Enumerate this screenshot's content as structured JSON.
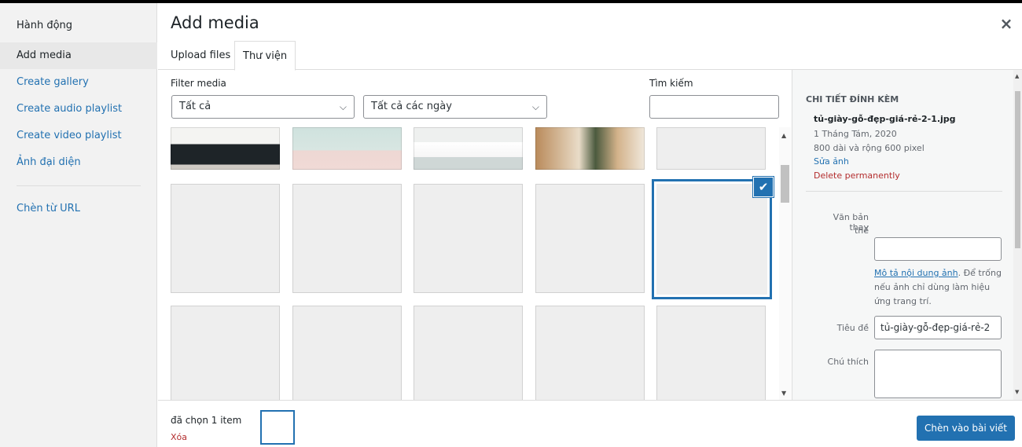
{
  "menu": {
    "heading": "Hành động",
    "items": [
      {
        "label": "Add media",
        "active": true
      },
      {
        "label": "Create gallery"
      },
      {
        "label": "Create audio playlist"
      },
      {
        "label": "Create video playlist"
      },
      {
        "label": "Ảnh đại diện"
      }
    ],
    "url_item": "Chèn từ URL"
  },
  "header": {
    "title": "Add media",
    "close_icon": "close-icon",
    "tabs": [
      {
        "label": "Upload files"
      },
      {
        "label": "Thư viện",
        "active": true
      }
    ]
  },
  "filters": {
    "label": "Filter media",
    "type_value": "Tất cả",
    "date_value": "Tất cả các ngày",
    "search_label": "Tìm kiếm",
    "search_value": ""
  },
  "grid": {
    "selected_index": 4,
    "check_icon": "checkmark-icon"
  },
  "details": {
    "heading": "CHI TIẾT ĐÍNH KÈM",
    "filename": "tủ-giày-gỗ-đẹp-giá-rẻ-2-1.jpg",
    "date": "1 Tháng Tám, 2020",
    "dimensions": "800 dài và rộng 600 pixel",
    "edit_link": "Sửa ảnh",
    "delete_link": "Delete permanently",
    "alt_label_1": "Văn bản thay",
    "alt_label_2": "thế",
    "alt_value": "",
    "alt_desc_link": "Mô tả nội dung ảnh",
    "alt_desc_1": ". Để trống",
    "alt_desc_2": "nếu ảnh chỉ dùng làm hiệu",
    "alt_desc_3": "ứng trang trí.",
    "title_label": "Tiêu đề",
    "title_value": "tủ-giày-gỗ-đẹp-giá-rẻ-2",
    "caption_label": "Chú thích",
    "caption_value": ""
  },
  "footer": {
    "selected_text": "đã chọn 1 item",
    "clear_label": "Xóa",
    "insert_button": "Chèn vào bài viết"
  }
}
